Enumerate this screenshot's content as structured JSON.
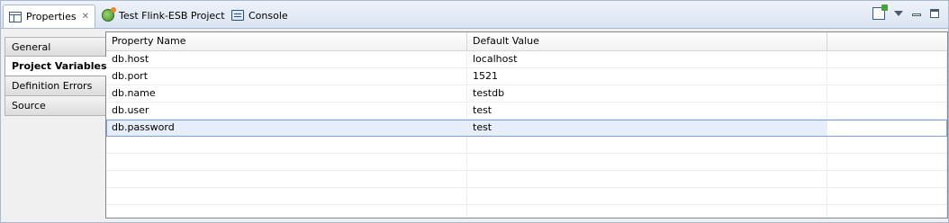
{
  "tabs": [
    {
      "label": "Properties",
      "icon": "properties-icon",
      "active": true
    },
    {
      "label": "Test Flink-ESB Project",
      "icon": "project-icon"
    },
    {
      "label": "Console",
      "icon": "console-icon"
    }
  ],
  "sidebar": {
    "items": [
      {
        "label": "General"
      },
      {
        "label": "Project Variables",
        "active": true
      },
      {
        "label": "Definition Errors"
      },
      {
        "label": "Source"
      }
    ]
  },
  "table": {
    "columns": [
      "Property Name",
      "Default Value"
    ],
    "rows": [
      [
        "db.host",
        "localhost"
      ],
      [
        "db.port",
        "1521"
      ],
      [
        "db.name",
        "testdb"
      ],
      [
        "db.user",
        "test"
      ],
      [
        "db.password",
        "test"
      ]
    ],
    "selected_row": 4,
    "empty_rows": 5
  },
  "colors": {
    "accent": "#7f9fd9",
    "tabbar": "#dae4f1",
    "selection": "#e6eefb"
  }
}
